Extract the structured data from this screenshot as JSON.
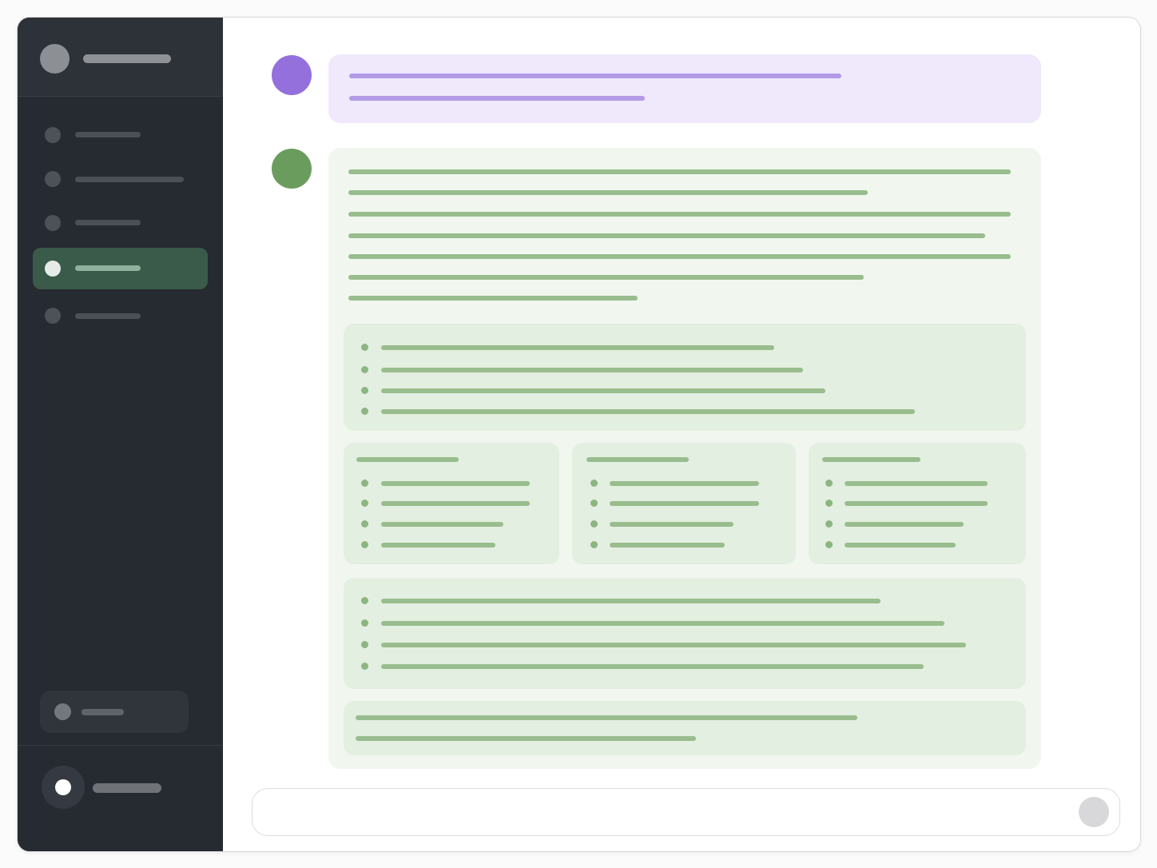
{
  "app": {
    "title": ""
  },
  "colors": {
    "sidebar_bg": "#262a31",
    "active_item": "#3a5a4a",
    "user_accent": "#9370db",
    "user_bubble": "#efe9fb",
    "assistant_accent": "#6a9c5e",
    "assistant_bubble": "#f1f7ef",
    "card_bg": "#e3efe0"
  },
  "sidebar": {
    "header": {
      "icon": "avatar-icon",
      "title": ""
    },
    "items": [
      {
        "label": "",
        "icon": "dot-icon",
        "active": false
      },
      {
        "label": "",
        "icon": "dot-icon",
        "active": false
      },
      {
        "label": "",
        "icon": "dot-icon",
        "active": false
      },
      {
        "label": "",
        "icon": "dot-icon",
        "active": true
      },
      {
        "label": "",
        "icon": "dot-icon",
        "active": false
      }
    ],
    "action_pill": {
      "label": "",
      "icon": "dot-icon"
    },
    "user": {
      "name": "",
      "icon": "user-avatar-icon"
    }
  },
  "conversation": {
    "messages": [
      {
        "role": "user",
        "avatar_icon": "user-avatar-icon",
        "text": ""
      },
      {
        "role": "assistant",
        "avatar_icon": "assistant-avatar-icon",
        "text": "",
        "sections": [
          {
            "type": "bullet-list",
            "items": [
              "",
              "",
              "",
              ""
            ]
          },
          {
            "type": "column-cards",
            "columns": [
              {
                "heading": "",
                "items": [
                  "",
                  "",
                  "",
                  ""
                ]
              },
              {
                "heading": "",
                "items": [
                  "",
                  "",
                  "",
                  ""
                ]
              },
              {
                "heading": "",
                "items": [
                  "",
                  "",
                  "",
                  ""
                ]
              }
            ]
          },
          {
            "type": "bullet-list",
            "items": [
              "",
              "",
              "",
              ""
            ]
          },
          {
            "type": "summary",
            "text": ""
          }
        ]
      }
    ]
  },
  "composer": {
    "placeholder": "",
    "send_icon": "send-icon"
  }
}
